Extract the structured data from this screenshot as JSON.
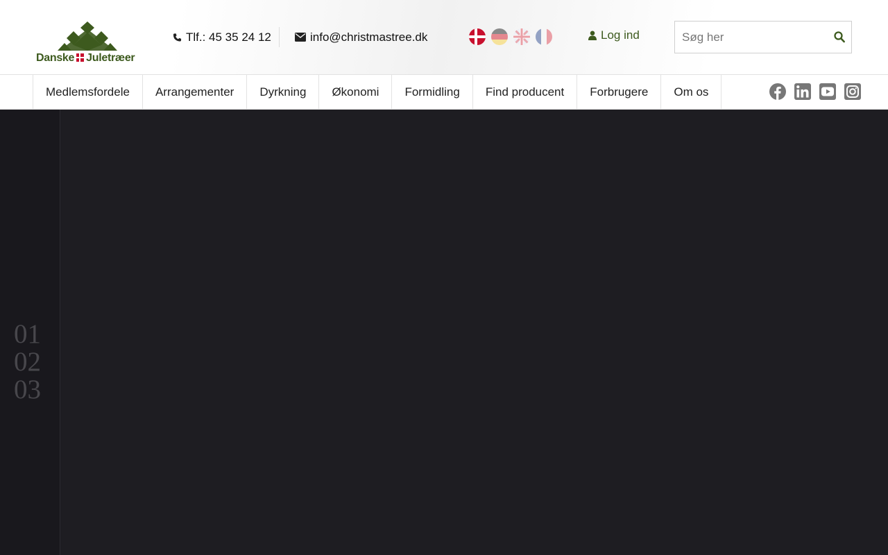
{
  "header": {
    "logo_text": {
      "left": "Danske",
      "right": "Juletræer"
    },
    "phone_label": "Tlf.: 45 35 24 12",
    "email_label": "info@christmastree.dk",
    "languages": [
      "Dansk",
      "Deutsch",
      "English",
      "Français"
    ],
    "login_label": "Log ind",
    "search_placeholder": "Søg her",
    "colors": {
      "brand_green": "#3d5a1e",
      "flag_red": "#c8102e"
    }
  },
  "nav": {
    "items": [
      "Medlemsfordele",
      "Arrangementer",
      "Dyrkning",
      "Økonomi",
      "Formidling",
      "Find producent",
      "Forbrugere",
      "Om os"
    ],
    "social": [
      "facebook-icon",
      "linkedin-icon",
      "youtube-icon",
      "instagram-icon"
    ]
  },
  "hero": {
    "slides": [
      "01",
      "02",
      "03"
    ],
    "colors": {
      "background": "#1e1d22",
      "sidebar": "#19181d"
    }
  }
}
